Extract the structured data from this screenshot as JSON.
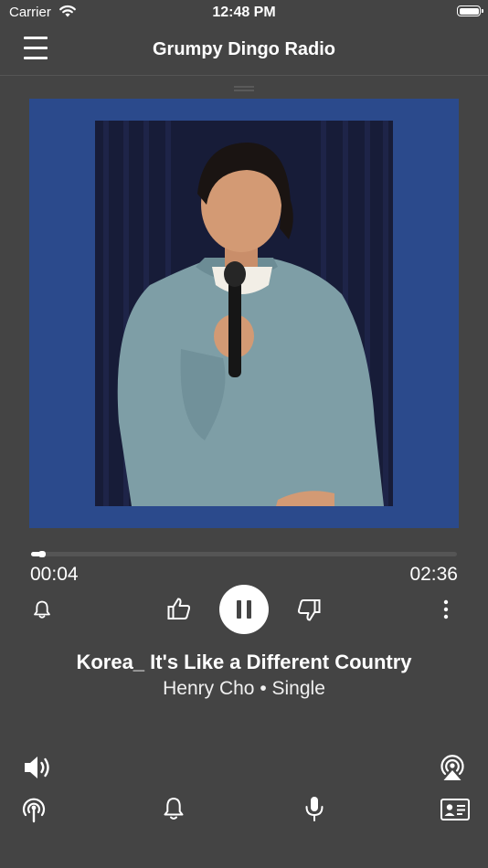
{
  "status_bar": {
    "carrier": "Carrier",
    "time": "12:48 PM",
    "wifi_icon": "wifi-icon",
    "battery_icon": "battery-icon"
  },
  "nav": {
    "title": "Grumpy Dingo Radio",
    "menu_icon": "hamburger-menu-icon"
  },
  "artwork": {
    "alt": "Album artwork: comedian holding a microphone",
    "background_color": "#2b4a8c"
  },
  "playback": {
    "elapsed": "00:04",
    "total": "02:36",
    "progress": 0.026
  },
  "controls": {
    "alarm_icon": "bell-icon",
    "like_icon": "thumbs-up-icon",
    "play_pause_icon": "pause-icon",
    "dislike_icon": "thumbs-down-icon",
    "more_icon": "more-vertical-icon"
  },
  "track": {
    "title": "Korea_ It's Like a Different Country",
    "subtitle": "Henry Cho • Single"
  },
  "bottom_bar": {
    "volume_icon": "volume-icon",
    "airplay_icon": "airplay-icon",
    "stream_icon": "broadcast-icon",
    "alerts_icon": "bell-icon",
    "mic_icon": "microphone-icon",
    "contact_icon": "contact-card-icon"
  },
  "colors": {
    "background": "#444444",
    "art_frame": "#2b4a8c",
    "foreground": "#ffffff"
  }
}
